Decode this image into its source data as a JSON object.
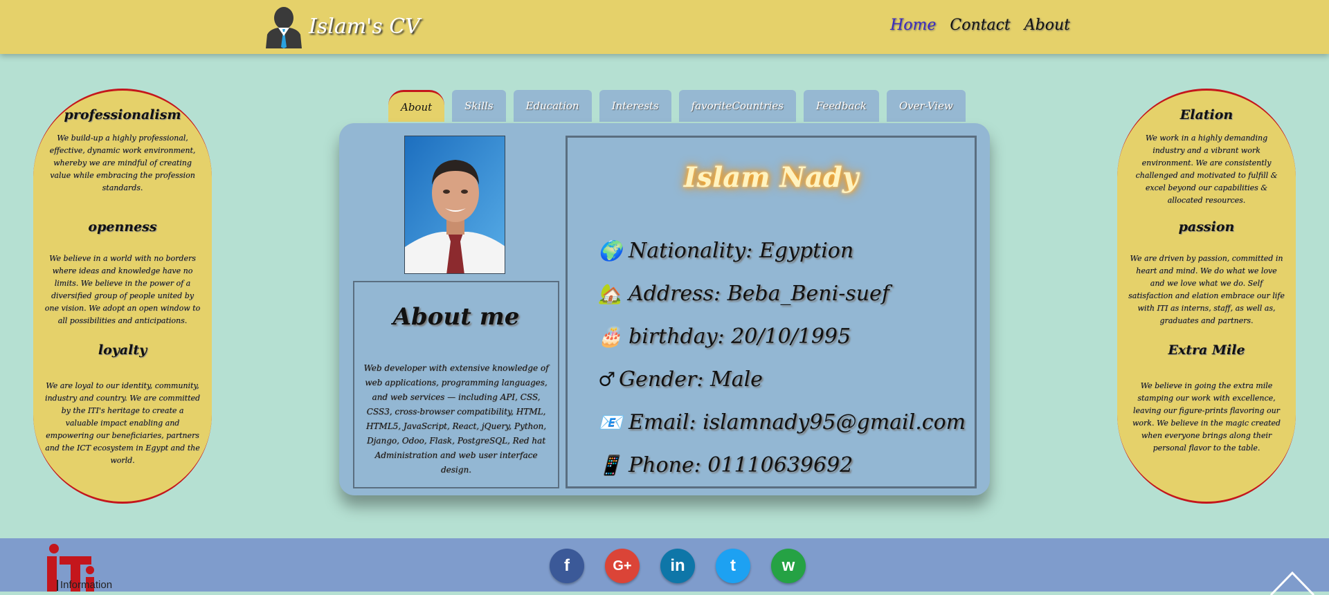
{
  "header": {
    "brand_title": "Islam's CV",
    "nav": [
      {
        "label": "Home",
        "active": true
      },
      {
        "label": "Contact",
        "active": false
      },
      {
        "label": "About",
        "active": false
      }
    ]
  },
  "left_values": [
    {
      "title": "professionalism",
      "text": "We build-up a highly professional, effective, dynamic work environment, whereby we are mindful of creating value while embracing the profession standards."
    },
    {
      "title": "openness",
      "text": "We believe in a world with no borders where ideas and knowledge have no limits. We believe in the power of a diversified group of people united by one vision. We adopt an open window to all possibilities and anticipations."
    },
    {
      "title": "loyalty",
      "text": "We are loyal to our identity, community, industry and country. We are committed by the ITI's heritage to create a valuable impact enabling and empowering our beneficiaries, partners and the ICT ecosystem in Egypt and the world."
    }
  ],
  "right_values": [
    {
      "title": "Elation",
      "text": "We work in a highly demanding industry and a vibrant work environment. We are consistently challenged and motivated to fulfill & excel beyond our capabilities & allocated resources."
    },
    {
      "title": "passion",
      "text": "We are driven by passion, committed in heart and mind. We do what we love and we love what we do. Self satisfaction and elation embrace our life with ITI as interns, staff, as well as, graduates and partners."
    },
    {
      "title": "Extra Mile",
      "text": "We believe in going the extra mile stamping our work with excellence, leaving our figure-prints flavoring our work. We believe in the magic created when everyone brings along their personal flavor to the table."
    }
  ],
  "tabs": [
    {
      "label": "About",
      "active": true
    },
    {
      "label": "Skills",
      "active": false
    },
    {
      "label": "Education",
      "active": false
    },
    {
      "label": "Interests",
      "active": false
    },
    {
      "label": "favoriteCountries",
      "active": false
    },
    {
      "label": "Feedback",
      "active": false
    },
    {
      "label": "Over-View",
      "active": false
    }
  ],
  "about": {
    "heading": "About me",
    "text": "Web developer with extensive knowledge of web applications, programming languages, and web services — including API, CSS, CSS3, cross-browser compatibility, HTML, HTML5, JavaScript, React, jQuery, Python, Django, Odoo, Flask, PostgreSQL, Red hat Administration and web user interface design."
  },
  "profile": {
    "name": "Islam Nady",
    "info": [
      {
        "icon": "🌍",
        "icon_name": "globe-icon",
        "text": "Nationality: Egyption"
      },
      {
        "icon": "🏡",
        "icon_name": "house-icon",
        "text": "Address: Beba_Beni-suef"
      },
      {
        "icon": "🎂",
        "icon_name": "cake-icon",
        "text": "birthday: 20/10/1995"
      },
      {
        "icon": "♂",
        "icon_name": "male-icon",
        "text": "Gender: Male"
      },
      {
        "icon": "📧",
        "icon_name": "email-icon",
        "text": "Email: islamnady95@gmail.com"
      },
      {
        "icon": "📱",
        "icon_name": "phone-icon",
        "text": "Phone: 01110639692"
      }
    ]
  },
  "footer": {
    "logo_text": "Information",
    "socials": [
      {
        "name": "facebook",
        "glyph": "f",
        "color": "#3b5998"
      },
      {
        "name": "google-plus",
        "glyph": "G+",
        "color": "#db4437"
      },
      {
        "name": "linkedin",
        "glyph": "in",
        "color": "#0e76a8"
      },
      {
        "name": "twitter",
        "glyph": "t",
        "color": "#1da1f2"
      },
      {
        "name": "whatsapp",
        "glyph": "w",
        "color": "#25a244"
      }
    ]
  },
  "colors": {
    "header_bg": "#e5d16a",
    "page_bg": "#b5e0d2",
    "card_bg": "#93b7d3",
    "footer_bg": "#7f9ccc",
    "accent_red": "#c4161c"
  }
}
